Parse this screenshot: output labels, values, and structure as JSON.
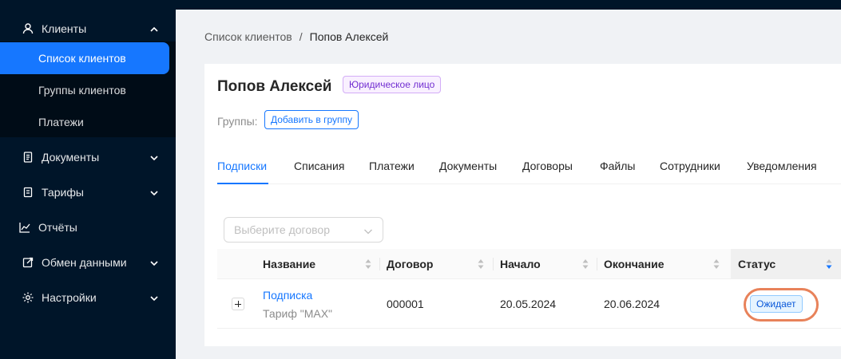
{
  "sidebar": {
    "clients": {
      "label": "Клиенты",
      "icon": "user-icon",
      "expanded": true
    },
    "client_subitems": [
      {
        "label": "Список клиентов",
        "active": true
      },
      {
        "label": "Группы клиентов",
        "active": false
      },
      {
        "label": "Платежи",
        "active": false
      }
    ],
    "items": [
      {
        "label": "Документы",
        "icon": "document-icon",
        "has_children": true
      },
      {
        "label": "Тарифы",
        "icon": "tariff-icon",
        "has_children": true
      },
      {
        "label": "Отчёты",
        "icon": "chart-icon",
        "has_children": false
      },
      {
        "label": "Обмен данными",
        "icon": "exchange-icon",
        "has_children": true
      },
      {
        "label": "Настройки",
        "icon": "gear-icon",
        "has_children": true
      }
    ],
    "colors": {
      "background": "#001529",
      "active": "#1677ff"
    }
  },
  "breadcrumb": {
    "parent": "Список клиентов",
    "separator": "/",
    "current": "Попов Алексей"
  },
  "client": {
    "name": "Попов Алексей",
    "type_badge": "Юридическое лицо",
    "groups_label": "Группы:",
    "add_group_button": "Добавить в группу"
  },
  "tabs": [
    {
      "label": "Подписки",
      "active": true
    },
    {
      "label": "Списания",
      "active": false
    },
    {
      "label": "Платежи",
      "active": false
    },
    {
      "label": "Документы",
      "active": false
    },
    {
      "label": "Договоры",
      "active": false
    },
    {
      "label": "Файлы",
      "active": false
    },
    {
      "label": "Сотрудники",
      "active": false
    },
    {
      "label": "Уведомления",
      "active": false
    }
  ],
  "contract_select": {
    "placeholder": "Выберите договор"
  },
  "table": {
    "columns": [
      {
        "label": "Название",
        "sortable": true
      },
      {
        "label": "Договор",
        "sortable": true
      },
      {
        "label": "Начало",
        "sortable": true
      },
      {
        "label": "Окончание",
        "sortable": true
      },
      {
        "label": "Статус",
        "sortable": true,
        "sorted": "descend"
      }
    ],
    "rows": [
      {
        "name": "Подписка",
        "tariff": "Тариф \"MAX\"",
        "contract": "000001",
        "start": "20.05.2024",
        "end": "20.06.2024",
        "status": "Ожидает",
        "status_highlighted": true
      }
    ]
  },
  "colors": {
    "accent": "#1677ff",
    "highlight_ring": "#e8825a",
    "type_badge": "#722ed1"
  }
}
